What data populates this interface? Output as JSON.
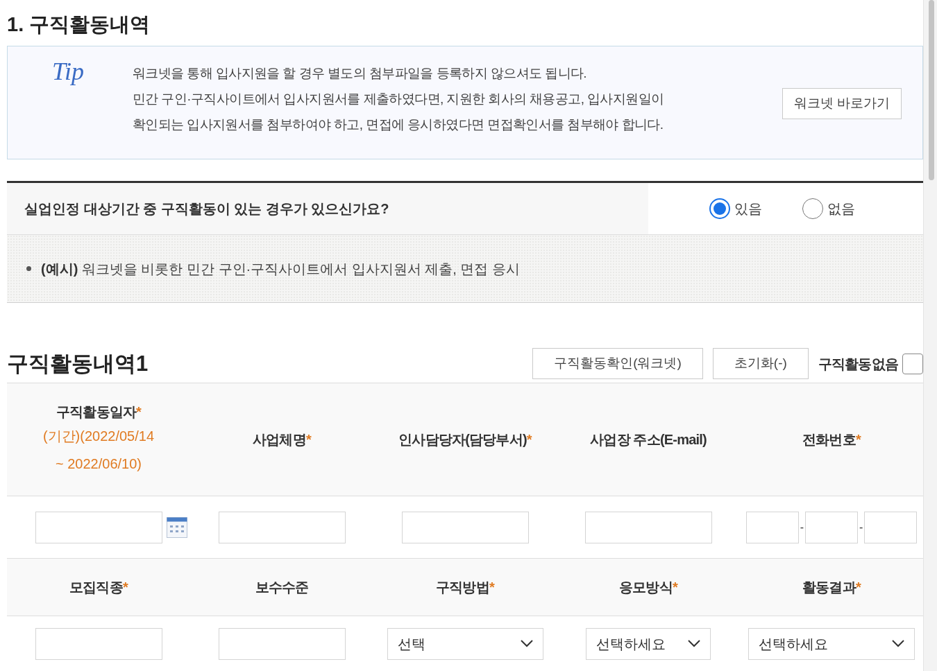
{
  "section_title": "1. 구직활동내역",
  "tip": {
    "label": "Tip",
    "lines": [
      "워크넷을 통해 입사지원을 할 경우 별도의 첨부파일을 등록하지 않으셔도 됩니다.",
      "민간 구인·구직사이트에서 입사지원서를 제출하였다면, 지원한 회사의 채용공고, 입사지원일이",
      "확인되는 입사지원서를 첨부하여야 하고, 면접에 응시하였다면 면접확인서를 첨부해야 합니다."
    ],
    "button": "워크넷 바로가기"
  },
  "question": {
    "text": "실업인정 대상기간 중 구직활동이 있는 경우가 있으신가요?",
    "options": [
      {
        "label": "있음",
        "selected": true
      },
      {
        "label": "없음",
        "selected": false
      }
    ]
  },
  "example": "**(예시)** 워크넷을 비롯한 민간 구인·구직사이트에서 입사지원서 제출, 면접 응시",
  "activity": {
    "title": "구직활동내역1",
    "buttons": [
      "구직활동확인(워크넷)",
      "초기화(-)"
    ],
    "no_activity": {
      "label": "구직활동없음",
      "checked": false
    }
  },
  "rows": [
    {
      "headers": [
        {
          "label": "구직활동일자",
          "mark": "*",
          "note_lines": [
            "(기간)(2022/05/14",
            "~ 2022/06/10)"
          ]
        },
        {
          "label": "사업체명",
          "mark": "*"
        },
        {
          "label": "인사담당자(담당부서)",
          "mark": "*"
        },
        {
          "label": "사업장 주소(E-mail)"
        },
        {
          "label": "전화번호",
          "mark": "*"
        }
      ],
      "fields": [
        {
          "kind": "date"
        },
        {
          "kind": "text"
        },
        {
          "kind": "text"
        },
        {
          "kind": "text"
        },
        {
          "kind": "phone",
          "separators": [
            "-",
            "-"
          ]
        }
      ]
    },
    {
      "headers": [
        {
          "label": "모집직종",
          "mark": "*"
        },
        {
          "label": "보수수준"
        },
        {
          "label": "구직방법",
          "mark": "*"
        },
        {
          "label": "응모방식",
          "mark": "*"
        },
        {
          "label": "활동결과",
          "mark": "*"
        }
      ],
      "fields": [
        {
          "kind": "text"
        },
        {
          "kind": "text"
        },
        {
          "kind": "select",
          "value": "선택"
        },
        {
          "kind": "select",
          "value": "선택하세요"
        },
        {
          "kind": "select",
          "value": "선택하세요"
        }
      ]
    }
  ]
}
